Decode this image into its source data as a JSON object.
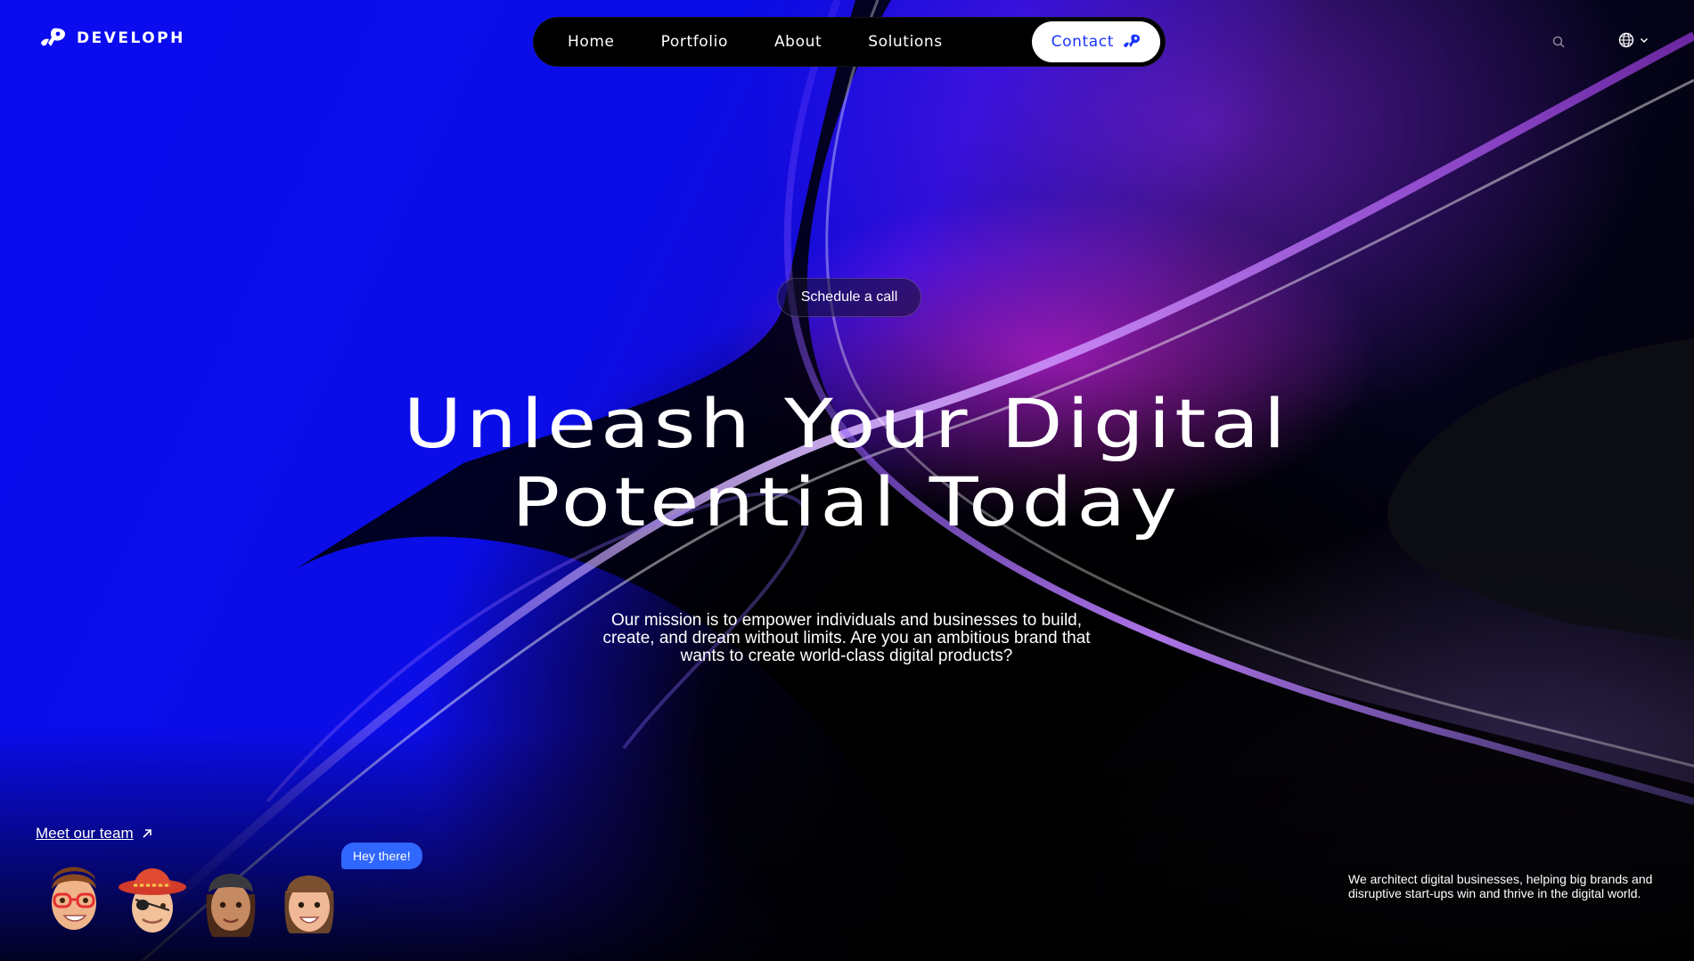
{
  "brand": {
    "name": "DEVELOPH",
    "logo_icon": "rocket-logo-icon"
  },
  "nav": {
    "items": [
      "Home",
      "Portfolio",
      "About",
      "Solutions"
    ],
    "contact_label": "Contact",
    "contact_icon": "rocket-icon"
  },
  "header": {
    "search_icon": "search-icon",
    "language_icon": "globe-icon",
    "language_chevron": "chevron-down-icon"
  },
  "hero": {
    "cta_label": "Schedule a call",
    "headline_line1": "Unleash Your Digital",
    "headline_line2": "Potential Today",
    "mission_line1": "Our mission is to empower individuals and businesses to build,",
    "mission_line2": "create, and dream without limits. Are you an ambitious brand that",
    "mission_line3": "wants to create world-class digital products?"
  },
  "team": {
    "link_label": "Meet our team",
    "link_icon": "arrow-up-right-icon",
    "bubble_text": "Hey there!"
  },
  "footer": {
    "tagline_line1": "We architect digital businesses, helping big brands and",
    "tagline_line2": "disruptive start-ups win and thrive in the digital world."
  },
  "colors": {
    "accent": "#1a35ff",
    "bubble": "#2f67ff",
    "background_blue": "#0a0cf0"
  }
}
